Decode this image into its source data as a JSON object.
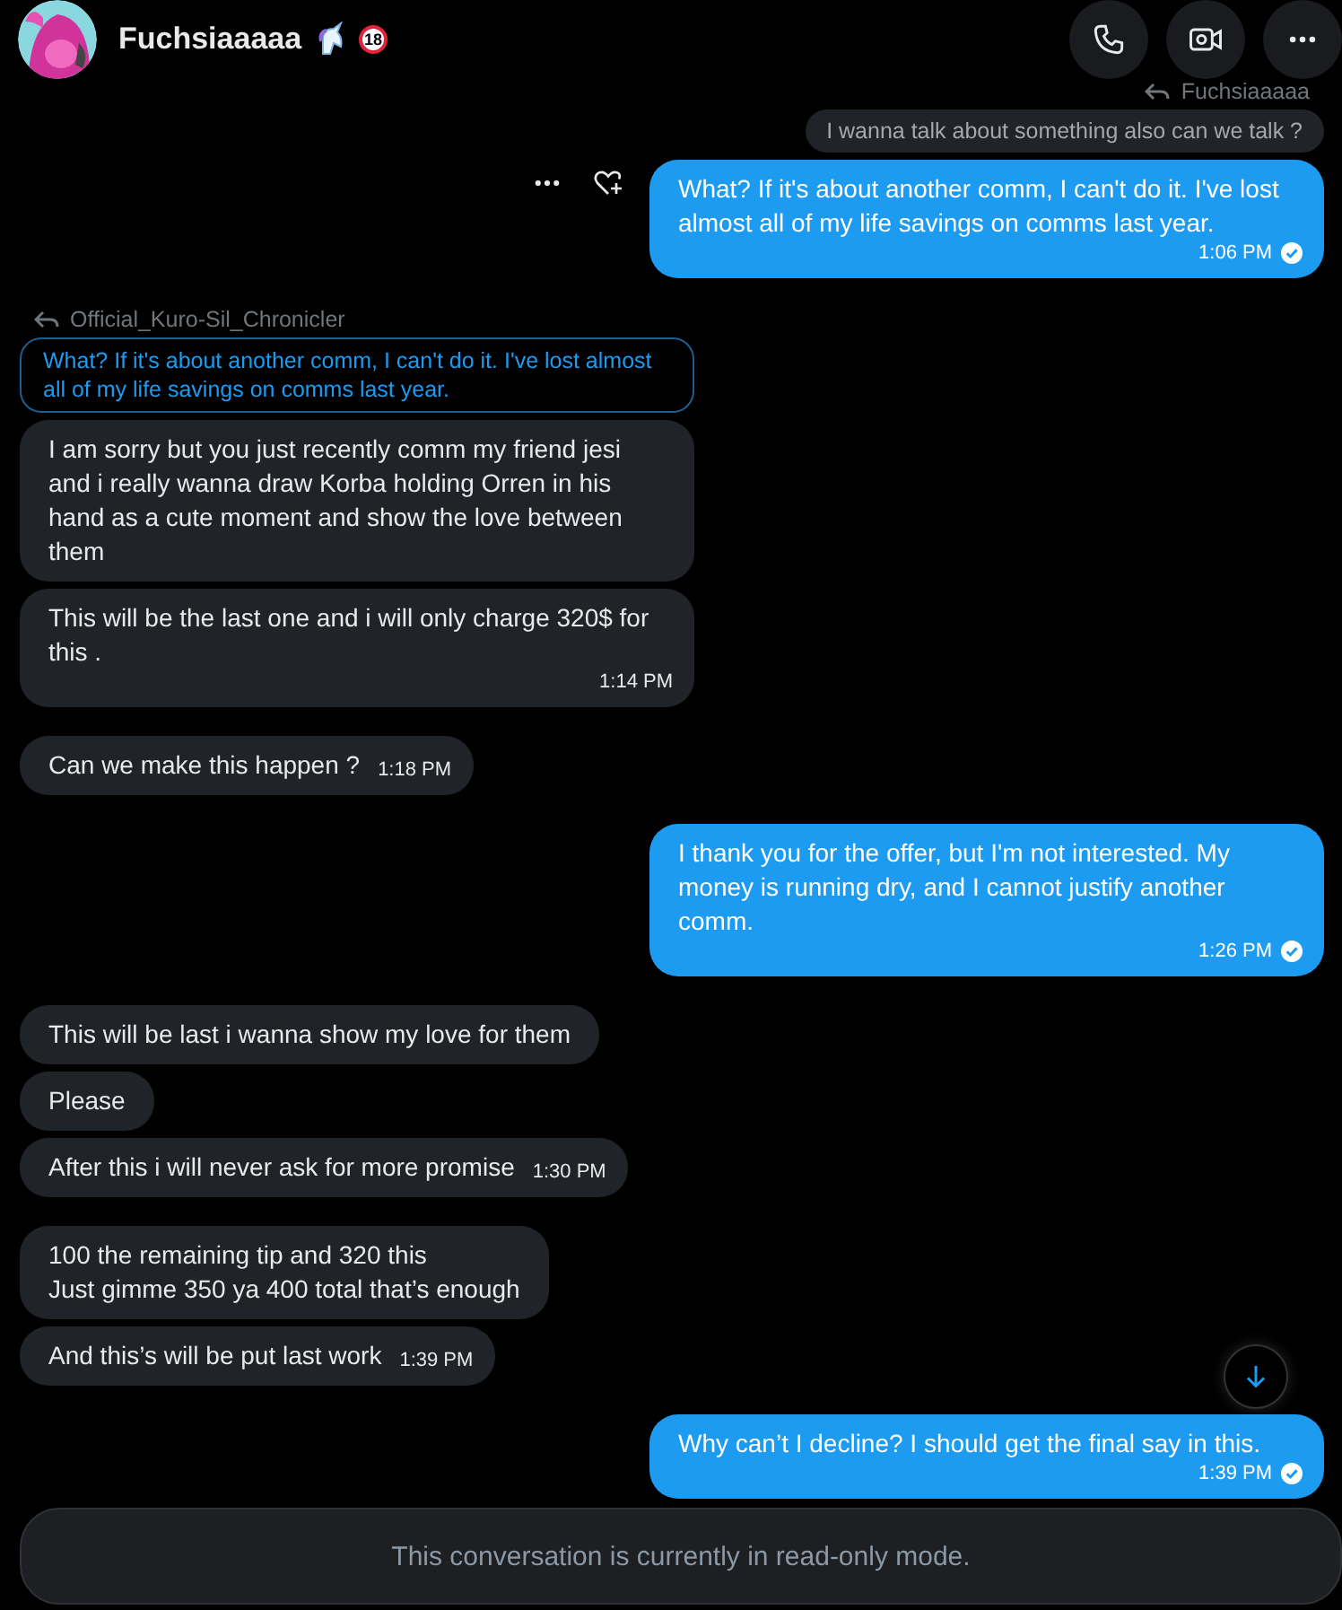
{
  "header": {
    "name": "Fuchsiaaaaa",
    "badge": "18",
    "actions": [
      {
        "kind": "call"
      },
      {
        "kind": "video"
      },
      {
        "kind": "more"
      }
    ]
  },
  "messages": [
    {
      "outgoing": true,
      "reply": {
        "author": "Fuchsiaaaaa",
        "text": "I wanna talk about something also can we talk ?"
      },
      "text": "What? If it's about another comm, I can't do it. I've lost almost all of my life savings on comms last year.",
      "time": "1:06 PM",
      "read": true,
      "hovered": true
    },
    {
      "outgoing": false,
      "reply": {
        "author": "Official_Kuro-Sil_Chronicler",
        "text": "What? If it's about another comm, I can't do it. I've lost almost all of my life savings on comms last year."
      },
      "text": "I am sorry but you just recently comm my friend jesi and i really wanna draw Korba holding Orren in his hand as a cute moment and show the love between them"
    },
    {
      "outgoing": false,
      "text": "This will be the last one and i will only charge 320$ for this .",
      "time": "1:14 PM"
    },
    {
      "outgoing": false,
      "text": "Can we make this happen ?",
      "time": "1:18 PM"
    },
    {
      "outgoing": true,
      "text": "I thank you for the offer, but I'm not interested. My money is running dry, and I cannot justify another comm.",
      "time": "1:26 PM",
      "read": true
    },
    {
      "outgoing": false,
      "text": "This  will be last i wanna show my love for them"
    },
    {
      "outgoing": false,
      "text": "Please"
    },
    {
      "outgoing": false,
      "text": "After this i will never ask for more promise",
      "time": "1:30 PM"
    },
    {
      "outgoing": false,
      "text": "100 the remaining tip and 320 this\nJust gimme 350 ya 400 total that’s enough"
    },
    {
      "outgoing": false,
      "text": "And this’s will be put last work",
      "time": "1:39 PM"
    },
    {
      "outgoing": true,
      "text": "Why can’t I decline? I should get the final say in this.",
      "time": "1:39 PM",
      "read": true
    }
  ],
  "composer": {
    "notice": "This conversation is currently in read-only mode."
  }
}
